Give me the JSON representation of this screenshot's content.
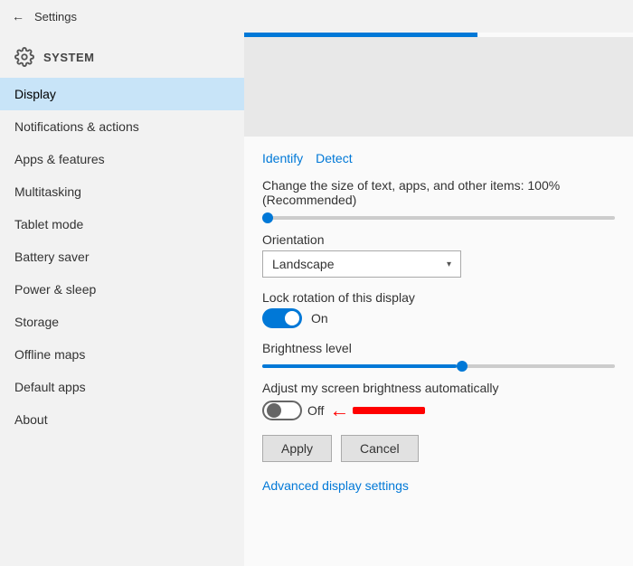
{
  "titlebar": {
    "title": "Settings",
    "back_label": "←"
  },
  "sidebar": {
    "system_title": "SYSTEM",
    "items": [
      {
        "id": "display",
        "label": "Display",
        "active": true
      },
      {
        "id": "notifications",
        "label": "Notifications & actions",
        "active": false
      },
      {
        "id": "apps",
        "label": "Apps & features",
        "active": false
      },
      {
        "id": "multitasking",
        "label": "Multitasking",
        "active": false
      },
      {
        "id": "tablet",
        "label": "Tablet mode",
        "active": false
      },
      {
        "id": "battery",
        "label": "Battery saver",
        "active": false
      },
      {
        "id": "power",
        "label": "Power & sleep",
        "active": false
      },
      {
        "id": "storage",
        "label": "Storage",
        "active": false
      },
      {
        "id": "offline",
        "label": "Offline maps",
        "active": false
      },
      {
        "id": "default",
        "label": "Default apps",
        "active": false
      },
      {
        "id": "about",
        "label": "About",
        "active": false
      }
    ]
  },
  "content": {
    "identify_label": "Identify",
    "detect_label": "Detect",
    "scale_label": "Change the size of text, apps, and other items: 100% (Recommended)",
    "scale_fill_pct": "0%",
    "orientation_label": "Orientation",
    "orientation_value": "Landscape",
    "lock_rotation_label": "Lock rotation of this display",
    "lock_toggle_state": "on",
    "lock_toggle_text": "On",
    "brightness_label": "Brightness level",
    "brightness_fill_pct": "55%",
    "brightness_thumb_left": "55%",
    "auto_brightness_label": "Adjust my screen brightness automatically",
    "auto_toggle_state": "off",
    "auto_toggle_text": "Off",
    "apply_label": "Apply",
    "cancel_label": "Cancel",
    "advanced_label": "Advanced display settings"
  }
}
